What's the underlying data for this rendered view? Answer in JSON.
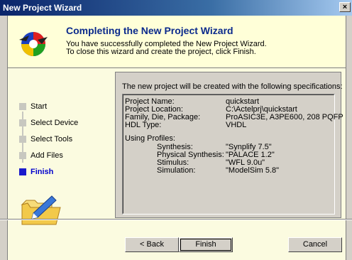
{
  "window": {
    "title": "New Project Wizard",
    "close_glyph": "×"
  },
  "header": {
    "title": "Completing the New Project Wizard",
    "line1": "You have successfully completed the New Project Wizard.",
    "line2": "To close this wizard and create the project, click Finish."
  },
  "steps": [
    {
      "label": "Start",
      "active": false
    },
    {
      "label": "Select Device",
      "active": false
    },
    {
      "label": "Select Tools",
      "active": false
    },
    {
      "label": "Add Files",
      "active": false
    },
    {
      "label": "Finish",
      "active": true
    }
  ],
  "summary": {
    "intro": "The new project will be created with the following specifications:",
    "fields": [
      {
        "label": "Project Name:",
        "value": "quickstart"
      },
      {
        "label": "Project Location:",
        "value": "C:\\Actelprj\\quickstart"
      },
      {
        "label": "Family, Die, Package:",
        "value": "ProASIC3E, A3PE600, 208 PQFP"
      },
      {
        "label": "HDL Type:",
        "value": "VHDL"
      }
    ],
    "profiles_label": "Using Profiles:",
    "profiles": [
      {
        "label": "Synthesis:",
        "value": "\"Synplify 7.5\""
      },
      {
        "label": "Physical Synthesis:",
        "value": "\"PALACE 1.2\""
      },
      {
        "label": "Stimulus:",
        "value": "\"WFL 9.0u\""
      },
      {
        "label": "Simulation:",
        "value": "\"ModelSim 5.8\""
      }
    ]
  },
  "buttons": {
    "back": "< Back",
    "finish": "Finish",
    "cancel": "Cancel"
  },
  "icons": {
    "wizard_logo": "wizard-logo-icon",
    "folder": "folder-pen-icon"
  }
}
